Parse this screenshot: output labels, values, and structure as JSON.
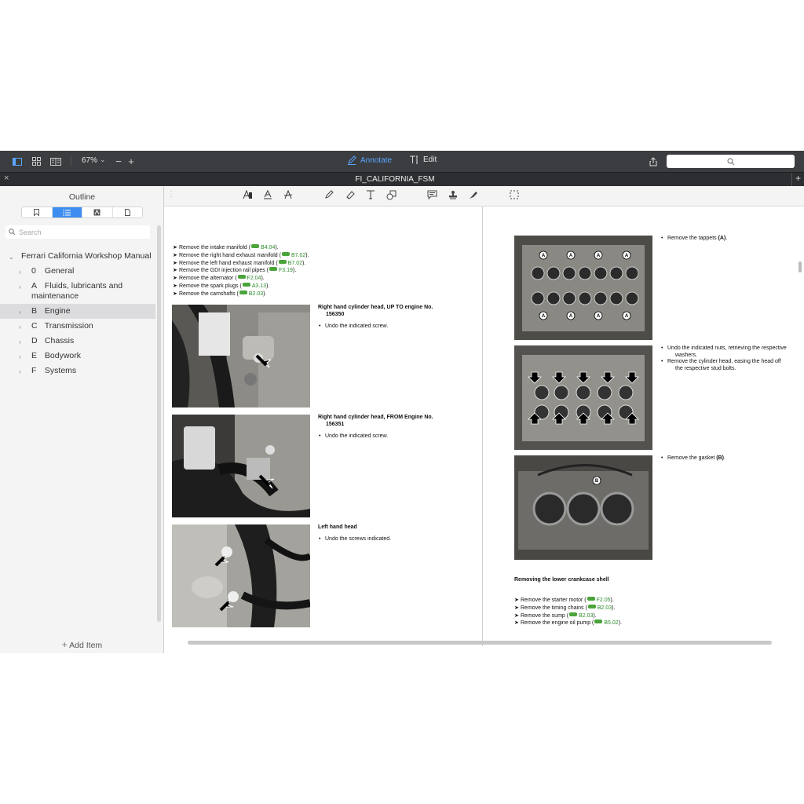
{
  "toolbar": {
    "zoom": "67%",
    "annotate_label": "Annotate",
    "edit_label": "Edit"
  },
  "tab": {
    "title": "FI_CALIFORNIA_FSM"
  },
  "sidebar": {
    "title": "Outline",
    "search_placeholder": "Search",
    "root": "Ferrari California Workshop Manual",
    "items": [
      {
        "code": "0",
        "label": "General"
      },
      {
        "code": "A",
        "label": "Fluids, lubricants and maintenance"
      },
      {
        "code": "B",
        "label": "Engine"
      },
      {
        "code": "C",
        "label": "Transmission"
      },
      {
        "code": "D",
        "label": "Chassis"
      },
      {
        "code": "E",
        "label": "Bodywork"
      },
      {
        "code": "F",
        "label": "Systems"
      }
    ],
    "add_item": "Add Item"
  },
  "left_page": {
    "steps": [
      {
        "text": "Remove the intake manifold (",
        "ref": "B4.04",
        "end": ")."
      },
      {
        "text": "Remove the right hand exhaust manifold (",
        "ref": "B7.02",
        "end": ")."
      },
      {
        "text": "Remove the left hand exhaust manifold (",
        "ref": "B7.02",
        "end": ")."
      },
      {
        "text": "Remove the GDI injection rail pipes (",
        "ref": "F3.19",
        "end": ")."
      },
      {
        "text": "Remove the alternator (",
        "ref": "F2.04",
        "end": ")."
      },
      {
        "text": "Remove the spark plugs (",
        "ref": "A3.13",
        "end": ")."
      },
      {
        "text": "Remove the camshafts (",
        "ref": "B2.03",
        "end": ")."
      }
    ],
    "sections": [
      {
        "heading": "Right hand cylinder head, UP TO engine No.",
        "heading2": "156350",
        "bullet": "Undo the indicated screw."
      },
      {
        "heading": "Right hand cylinder head, FROM Engine No.",
        "heading2": "156351",
        "bullet": "Undo the indicated screw."
      },
      {
        "heading": "Left hand head",
        "heading2": "",
        "bullet": "Undo the screws indicated."
      }
    ]
  },
  "right_page": {
    "bullet1": "Remove the tappets ",
    "bullet1_bold": "(A)",
    "bullet1_end": ".",
    "bullet2a": "Undo the indicated nuts, retrieving the respective",
    "bullet2b": "washers.",
    "bullet3a": "Remove the cylinder head, easing the head off",
    "bullet3b": "the respective stud bolts.",
    "bullet4": "Remove the gasket ",
    "bullet4_bold": "(B)",
    "bullet4_end": ".",
    "callout_a": "A",
    "callout_b": "B",
    "heading": "Removing the lower crankcase shell",
    "steps": [
      {
        "text": "Remove the starter motor (",
        "ref": "F2.05",
        "end": ")."
      },
      {
        "text": "Remove the timing chains (",
        "ref": "B2.03",
        "end": ")."
      },
      {
        "text": "Remove the sump (",
        "ref": "B2.03",
        "end": ")."
      },
      {
        "text": "Remove the engine oil pump (",
        "ref": "B5.02",
        "end": ")."
      }
    ]
  },
  "colors": {
    "toolbar_bg": "#3b3d40",
    "accent": "#3d8ef0",
    "ref_green": "#2a8a2a"
  }
}
